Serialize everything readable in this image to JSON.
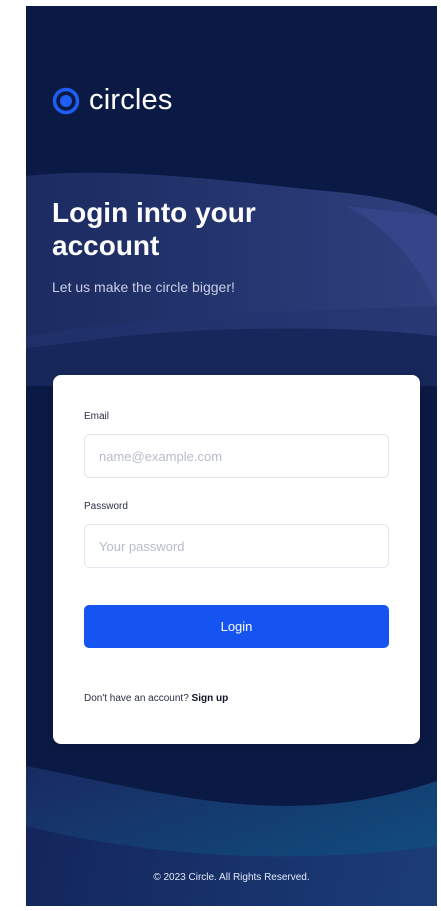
{
  "brand": {
    "name": "circles",
    "logo_icon": "ring-dot-icon",
    "accent": "#1f5ef5"
  },
  "hero": {
    "title": "Login into your account",
    "subtitle": "Let us make the circle bigger!"
  },
  "form": {
    "email_label": "Email",
    "email_placeholder": "name@example.com",
    "email_value": "",
    "password_label": "Password",
    "password_placeholder": "Your password",
    "password_value": "",
    "login_label": "Login",
    "login_color": "#1554f0"
  },
  "signup": {
    "prompt": "Don't have an account?",
    "link_label": "Sign up"
  },
  "footer": {
    "copyright": "© 2023 Circle. All Rights Reserved."
  },
  "colors": {
    "background": "#0b1a44",
    "card": "#ffffff"
  }
}
